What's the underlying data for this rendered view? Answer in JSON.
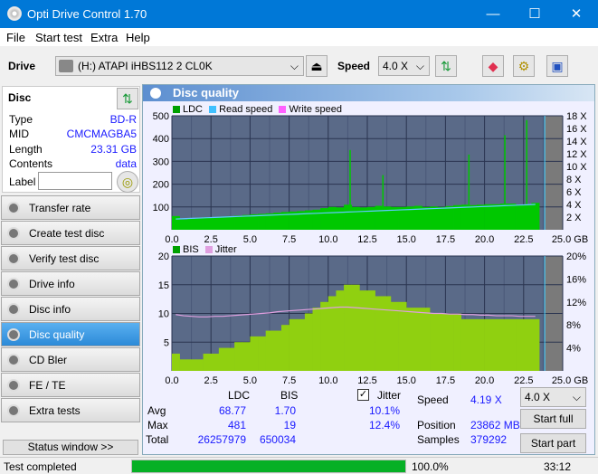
{
  "window": {
    "title": "Opti Drive Control 1.70",
    "minimize": "—",
    "maximize": "☐",
    "close": "✕"
  },
  "menu": [
    "File",
    "Start test",
    "Extra",
    "Help"
  ],
  "toolbar": {
    "drive_label": "Drive",
    "drive_value": "(H:)  ATAPI iHBS112  2 CL0K",
    "speed_label": "Speed",
    "speed_value": "4.0 X",
    "icons": [
      "eject-icon",
      "refresh-icon",
      "eraser-icon",
      "settings-icon",
      "save-icon"
    ]
  },
  "disc": {
    "title": "Disc",
    "fields": [
      {
        "k": "Type",
        "v": "BD-R"
      },
      {
        "k": "MID",
        "v": "CMCMAGBA5"
      },
      {
        "k": "Length",
        "v": "23.31 GB"
      },
      {
        "k": "Contents",
        "v": "data"
      }
    ],
    "label_label": "Label",
    "label_value": ""
  },
  "nav": [
    {
      "label": "Transfer rate"
    },
    {
      "label": "Create test disc"
    },
    {
      "label": "Verify test disc"
    },
    {
      "label": "Drive info"
    },
    {
      "label": "Disc info"
    },
    {
      "label": "Disc quality",
      "active": true
    },
    {
      "label": "CD Bler"
    },
    {
      "label": "FE / TE"
    },
    {
      "label": "Extra tests"
    }
  ],
  "status_window_btn": "Status window >>",
  "panel_title": "Disc quality",
  "colors": {
    "ldc": "#00c000",
    "read": "#40c0ff",
    "write": "#ff60ff",
    "bis": "#a0d000",
    "jitter": "#e0a0e0",
    "plot_bg": "#5a6a88",
    "accent": "#0078d7"
  },
  "chart_data": [
    {
      "type": "bar",
      "legend": [
        "LDC",
        "Read speed",
        "Write speed"
      ],
      "x_ticks": [
        "0.0",
        "2.5",
        "5.0",
        "7.5",
        "10.0",
        "12.5",
        "15.0",
        "17.5",
        "20.0",
        "22.5",
        "25.0 GB"
      ],
      "y_ticks": [
        "100",
        "200",
        "300",
        "400",
        "500"
      ],
      "y2_ticks": [
        "2 X",
        "4 X",
        "6 X",
        "8 X",
        "10 X",
        "12 X",
        "14 X",
        "16 X",
        "18 X"
      ],
      "xlim": [
        0,
        25
      ],
      "ylim": [
        0,
        500
      ],
      "y2lim": [
        0,
        18
      ],
      "x_step": 0.5,
      "ldc": [
        60,
        45,
        48,
        52,
        55,
        55,
        58,
        60,
        62,
        65,
        68,
        70,
        72,
        75,
        78,
        80,
        82,
        85,
        88,
        95,
        100,
        98,
        110,
        100,
        98,
        100,
        105,
        102,
        100,
        100,
        102,
        105,
        100,
        102,
        100,
        104,
        108,
        110,
        108,
        110,
        112,
        112,
        115,
        115,
        110,
        112,
        118
      ],
      "ldc_spikes": [
        {
          "x": 11.4,
          "y": 350
        },
        {
          "x": 13.5,
          "y": 240
        },
        {
          "x": 19.0,
          "y": 330
        },
        {
          "x": 21.3,
          "y": 415
        },
        {
          "x": 22.7,
          "y": 481
        }
      ],
      "read_speed": [
        1.7,
        1.75,
        1.8,
        1.85,
        1.9,
        1.95,
        2.0,
        2.05,
        2.1,
        2.15,
        2.2,
        2.25,
        2.3,
        2.35,
        2.4,
        2.45,
        2.5,
        2.55,
        2.6,
        2.65,
        2.7,
        2.75,
        2.8,
        2.85,
        2.9,
        2.95,
        3.0,
        3.05,
        3.1,
        3.15,
        3.2,
        3.25,
        3.3,
        3.35,
        3.4,
        3.45,
        3.5,
        3.55,
        3.6,
        3.65,
        3.7,
        3.75,
        3.8,
        3.85,
        3.9,
        3.95,
        4.0
      ]
    },
    {
      "type": "bar",
      "legend": [
        "BIS",
        "Jitter"
      ],
      "x_ticks": [
        "0.0",
        "2.5",
        "5.0",
        "7.5",
        "10.0",
        "12.5",
        "15.0",
        "17.5",
        "20.0",
        "22.5",
        "25.0 GB"
      ],
      "y_ticks": [
        "5",
        "10",
        "15",
        "20"
      ],
      "y2_ticks": [
        "4%",
        "8%",
        "12%",
        "16%",
        "20%"
      ],
      "xlim": [
        0,
        25
      ],
      "ylim": [
        0,
        20
      ],
      "y2lim": [
        0,
        20
      ],
      "x_step": 0.5,
      "bis": [
        3,
        2,
        2,
        2,
        3,
        3,
        4,
        4,
        5,
        5,
        6,
        6,
        7,
        7,
        8,
        9,
        9,
        10,
        11,
        12,
        13,
        14,
        15,
        15,
        14,
        14,
        13,
        13,
        12,
        12,
        11,
        11,
        11,
        10,
        10,
        10,
        10,
        9,
        9,
        9,
        9,
        9,
        9,
        9,
        9,
        9,
        9
      ],
      "jitter": [
        9.8,
        9.6,
        9.5,
        9.4,
        9.4,
        9.5,
        9.5,
        9.6,
        9.7,
        9.8,
        9.9,
        10.0,
        10.1,
        10.3,
        10.4,
        10.5,
        10.6,
        10.7,
        10.8,
        10.9,
        11.0,
        11.1,
        11.1,
        11.0,
        10.9,
        10.8,
        10.7,
        10.6,
        10.5,
        10.4,
        10.3,
        10.2,
        10.1,
        10.0,
        10.0,
        9.9,
        9.9,
        9.8,
        9.8,
        9.7,
        9.7,
        9.6,
        9.6,
        9.6,
        9.5,
        9.5,
        9.5
      ]
    }
  ],
  "stats": {
    "col_ldc": "LDC",
    "col_bis": "BIS",
    "rows": [
      {
        "k": "Avg",
        "ldc": "68.77",
        "bis": "1.70",
        "jit": "10.1%"
      },
      {
        "k": "Max",
        "ldc": "481",
        "bis": "19",
        "jit": "12.4%"
      },
      {
        "k": "Total",
        "ldc": "26257979",
        "bis": "650034",
        "jit": ""
      }
    ],
    "jitter_label": "Jitter",
    "jitter_checked": true,
    "speed_label": "Speed",
    "speed_value": "4.19 X",
    "position_label": "Position",
    "position_value": "23862 MB",
    "samples_label": "Samples",
    "samples_value": "379292",
    "speed_select": "4.0 X",
    "start_full": "Start full",
    "start_part": "Start part"
  },
  "status": {
    "text": "Test completed",
    "progress": 100.0,
    "progress_text": "100.0%",
    "time": "33:12"
  }
}
